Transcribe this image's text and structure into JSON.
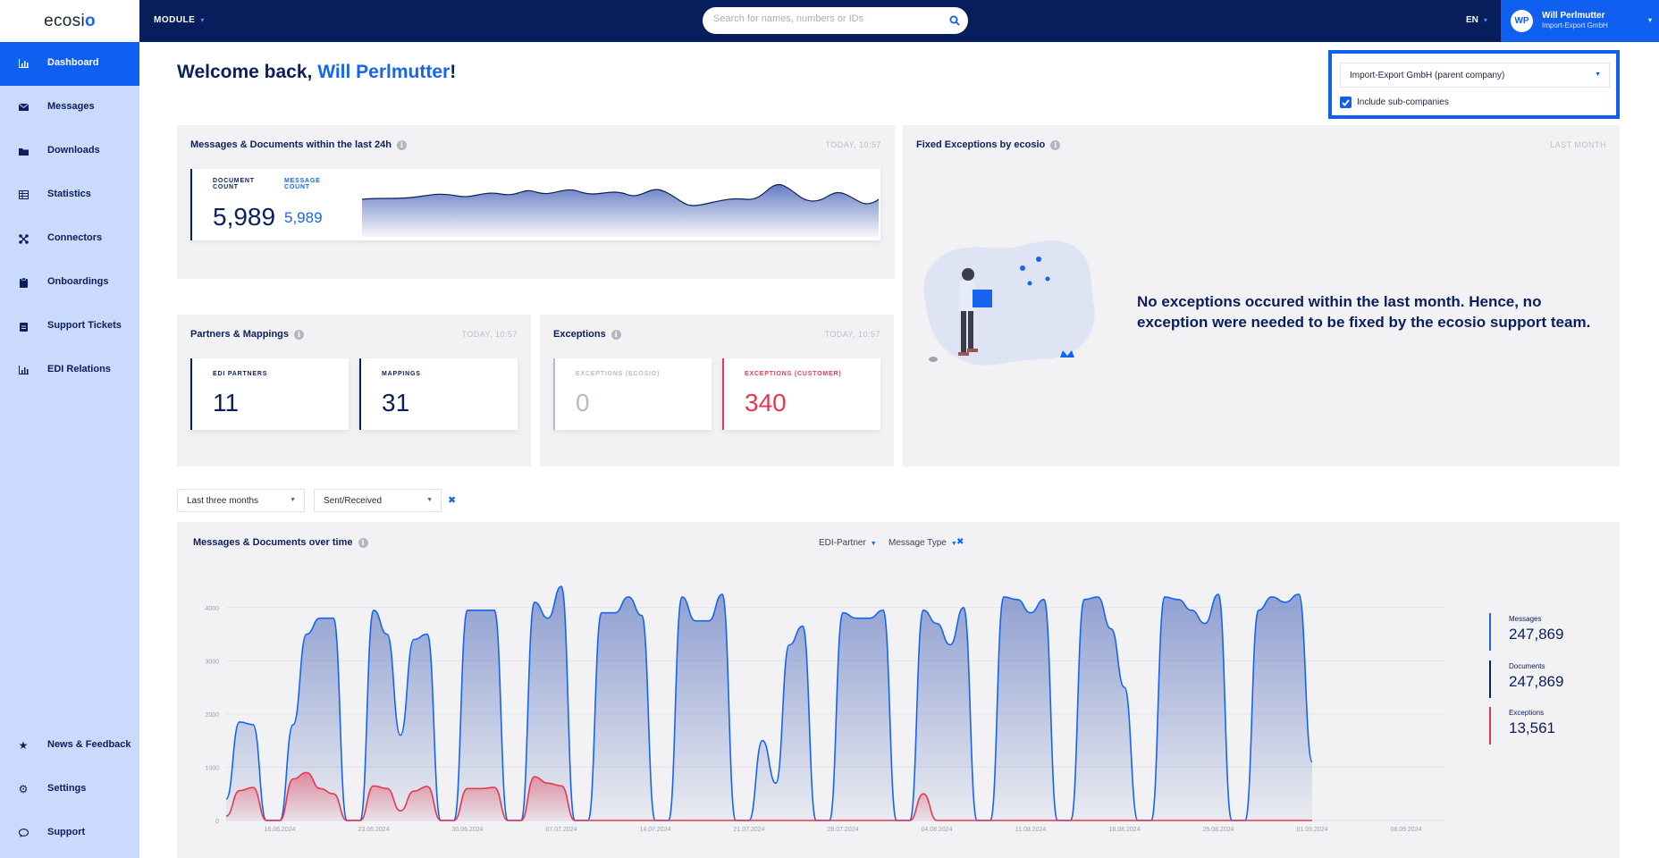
{
  "header": {
    "logo": "ecosio",
    "module_label": "MODULE",
    "search_placeholder": "Search for names, numbers or IDs",
    "language": "EN",
    "user_initials": "WP",
    "user_name": "Will Perlmutter",
    "user_company": "Import-Export GmbH"
  },
  "sidebar": {
    "items": [
      {
        "label": "Dashboard",
        "icon": "bar-chart-icon"
      },
      {
        "label": "Messages",
        "icon": "envelope-icon"
      },
      {
        "label": "Downloads",
        "icon": "folder-icon"
      },
      {
        "label": "Statistics",
        "icon": "table-icon"
      },
      {
        "label": "Connectors",
        "icon": "connectors-icon"
      },
      {
        "label": "Onboardings",
        "icon": "clipboard-icon"
      },
      {
        "label": "Support Tickets",
        "icon": "ticket-icon"
      },
      {
        "label": "EDI Relations",
        "icon": "bar-chart-icon"
      }
    ],
    "bottom": [
      {
        "label": "News & Feedback",
        "icon": "star-icon"
      },
      {
        "label": "Settings",
        "icon": "gear-icon"
      },
      {
        "label": "Support",
        "icon": "chat-icon"
      }
    ]
  },
  "welcome": {
    "prefix": "Welcome back, ",
    "name": "Will Perlmutter",
    "suffix": "!"
  },
  "company": {
    "selected": "Import-Export GmbH (parent company)",
    "include_sub": "Include sub-companies",
    "include_sub_checked": true
  },
  "last24": {
    "title": "Messages & Documents within the last 24h",
    "time": "TODAY, 10:57",
    "doc_label": "DOCUMENT COUNT",
    "doc_value": "5,989",
    "msg_label": "MESSAGE COUNT",
    "msg_value": "5,989"
  },
  "fixed": {
    "title": "Fixed Exceptions by ecosio",
    "time": "LAST MONTH",
    "message": "No exceptions occured within the last month. Hence, no exception were needed to be fixed by the ecosio support team."
  },
  "partners": {
    "title": "Partners & Mappings",
    "time": "TODAY, 10:57",
    "edi_label": "EDI PARTNERS",
    "edi_value": "11",
    "map_label": "MAPPINGS",
    "map_value": "31"
  },
  "exceptions": {
    "title": "Exceptions",
    "time": "TODAY, 10:57",
    "ecosio_label": "EXCEPTIONS (ECOSIO)",
    "ecosio_value": "0",
    "customer_label": "EXCEPTIONS (CUSTOMER)",
    "customer_value": "340"
  },
  "filters": {
    "period": "Last three months",
    "direction": "Sent/Received"
  },
  "overtime": {
    "title": "Messages & Documents over time",
    "partner_filter": "EDI-Partner",
    "type_filter": "Message Type",
    "legend": [
      {
        "label": "Messages",
        "value": "247,869",
        "color": "#1565f0"
      },
      {
        "label": "Documents",
        "value": "247,869",
        "color": "#0a1f5c"
      },
      {
        "label": "Exceptions",
        "value": "13,561",
        "color": "#e6394f"
      }
    ]
  },
  "chart_data": {
    "type": "area",
    "title": "Messages & Documents over time",
    "ylim": [
      0,
      4500
    ],
    "yticks": [
      "0",
      "1000",
      "2000",
      "3000",
      "4000"
    ],
    "xticks": [
      "16.06.2024",
      "23.06.2024",
      "30.06.2024",
      "07.07.2024",
      "14.07.2024",
      "21.07.2024",
      "28.07.2024",
      "04.08.2024",
      "11.08.2024",
      "18.08.2024",
      "25.08.2024",
      "01.09.2024",
      "08.09.2024"
    ],
    "x": [
      "12.06.2024",
      "13.06.2024",
      "14.06.2024",
      "15.06.2024",
      "16.06.2024",
      "17.06.2024",
      "18.06.2024",
      "19.06.2024",
      "20.06.2024",
      "21.06.2024",
      "22.06.2024",
      "23.06.2024",
      "24.06.2024",
      "25.06.2024",
      "26.06.2024",
      "27.06.2024",
      "28.06.2024",
      "29.06.2024",
      "30.06.2024",
      "01.07.2024",
      "02.07.2024",
      "03.07.2024",
      "04.07.2024",
      "05.07.2024",
      "06.07.2024",
      "07.07.2024",
      "08.07.2024",
      "09.07.2024",
      "10.07.2024",
      "11.07.2024",
      "12.07.2024",
      "13.07.2024",
      "14.07.2024",
      "15.07.2024",
      "16.07.2024",
      "17.07.2024",
      "18.07.2024",
      "19.07.2024",
      "20.07.2024",
      "21.07.2024",
      "22.07.2024",
      "23.07.2024",
      "24.07.2024",
      "25.07.2024",
      "26.07.2024",
      "27.07.2024",
      "28.07.2024",
      "29.07.2024",
      "30.07.2024",
      "31.07.2024",
      "01.08.2024",
      "02.08.2024",
      "03.08.2024",
      "04.08.2024",
      "05.08.2024",
      "06.08.2024",
      "07.08.2024",
      "08.08.2024",
      "09.08.2024",
      "10.08.2024",
      "11.08.2024",
      "12.08.2024",
      "13.08.2024",
      "14.08.2024",
      "15.08.2024",
      "16.08.2024",
      "17.08.2024",
      "18.08.2024",
      "19.08.2024",
      "20.08.2024",
      "21.08.2024",
      "22.08.2024",
      "23.08.2024",
      "24.08.2024",
      "25.08.2024",
      "26.08.2024",
      "27.08.2024",
      "28.08.2024",
      "29.08.2024",
      "30.08.2024",
      "31.08.2024",
      "01.09.2024",
      "02.09.2024",
      "03.09.2024",
      "04.09.2024",
      "05.09.2024",
      "06.09.2024",
      "07.09.2024",
      "08.09.2024",
      "09.09.2024",
      "10.09.2024",
      "11.09.2024"
    ],
    "series": [
      {
        "name": "Messages",
        "values": [
          400,
          1850,
          1800,
          0,
          0,
          1800,
          3500,
          3800,
          3800,
          0,
          0,
          3950,
          3500,
          1600,
          3400,
          3500,
          0,
          0,
          3950,
          3950,
          3950,
          0,
          0,
          4100,
          3800,
          4400,
          0,
          0,
          3900,
          3900,
          4200,
          3850,
          0,
          0,
          4200,
          3750,
          3750,
          4250,
          0,
          0,
          1500,
          700,
          3300,
          3650,
          0,
          0,
          3900,
          3800,
          3800,
          3950,
          0,
          0,
          3950,
          3700,
          3300,
          4000,
          0,
          0,
          4200,
          4150,
          3900,
          4150,
          0,
          0,
          4150,
          4200,
          3600,
          2500,
          0,
          0,
          4200,
          4150,
          3950,
          3700,
          4250,
          0,
          0,
          3950,
          4200,
          4100,
          4250,
          1100
        ]
      },
      {
        "name": "Exceptions",
        "values": [
          80,
          560,
          620,
          0,
          0,
          780,
          900,
          600,
          500,
          0,
          0,
          650,
          600,
          180,
          550,
          640,
          0,
          0,
          600,
          600,
          620,
          0,
          0,
          820,
          700,
          650,
          0,
          0,
          0,
          0,
          0,
          0,
          0,
          0,
          0,
          0,
          0,
          0,
          0,
          0,
          0,
          0,
          0,
          0,
          0,
          0,
          0,
          0,
          0,
          0,
          0,
          0,
          500,
          0,
          0,
          0,
          0,
          0,
          0,
          0,
          0,
          0,
          0,
          0,
          0,
          0,
          0,
          0,
          0,
          0,
          0,
          0,
          0,
          0,
          0,
          0,
          0,
          0,
          0,
          0,
          0,
          0
        ]
      }
    ]
  }
}
